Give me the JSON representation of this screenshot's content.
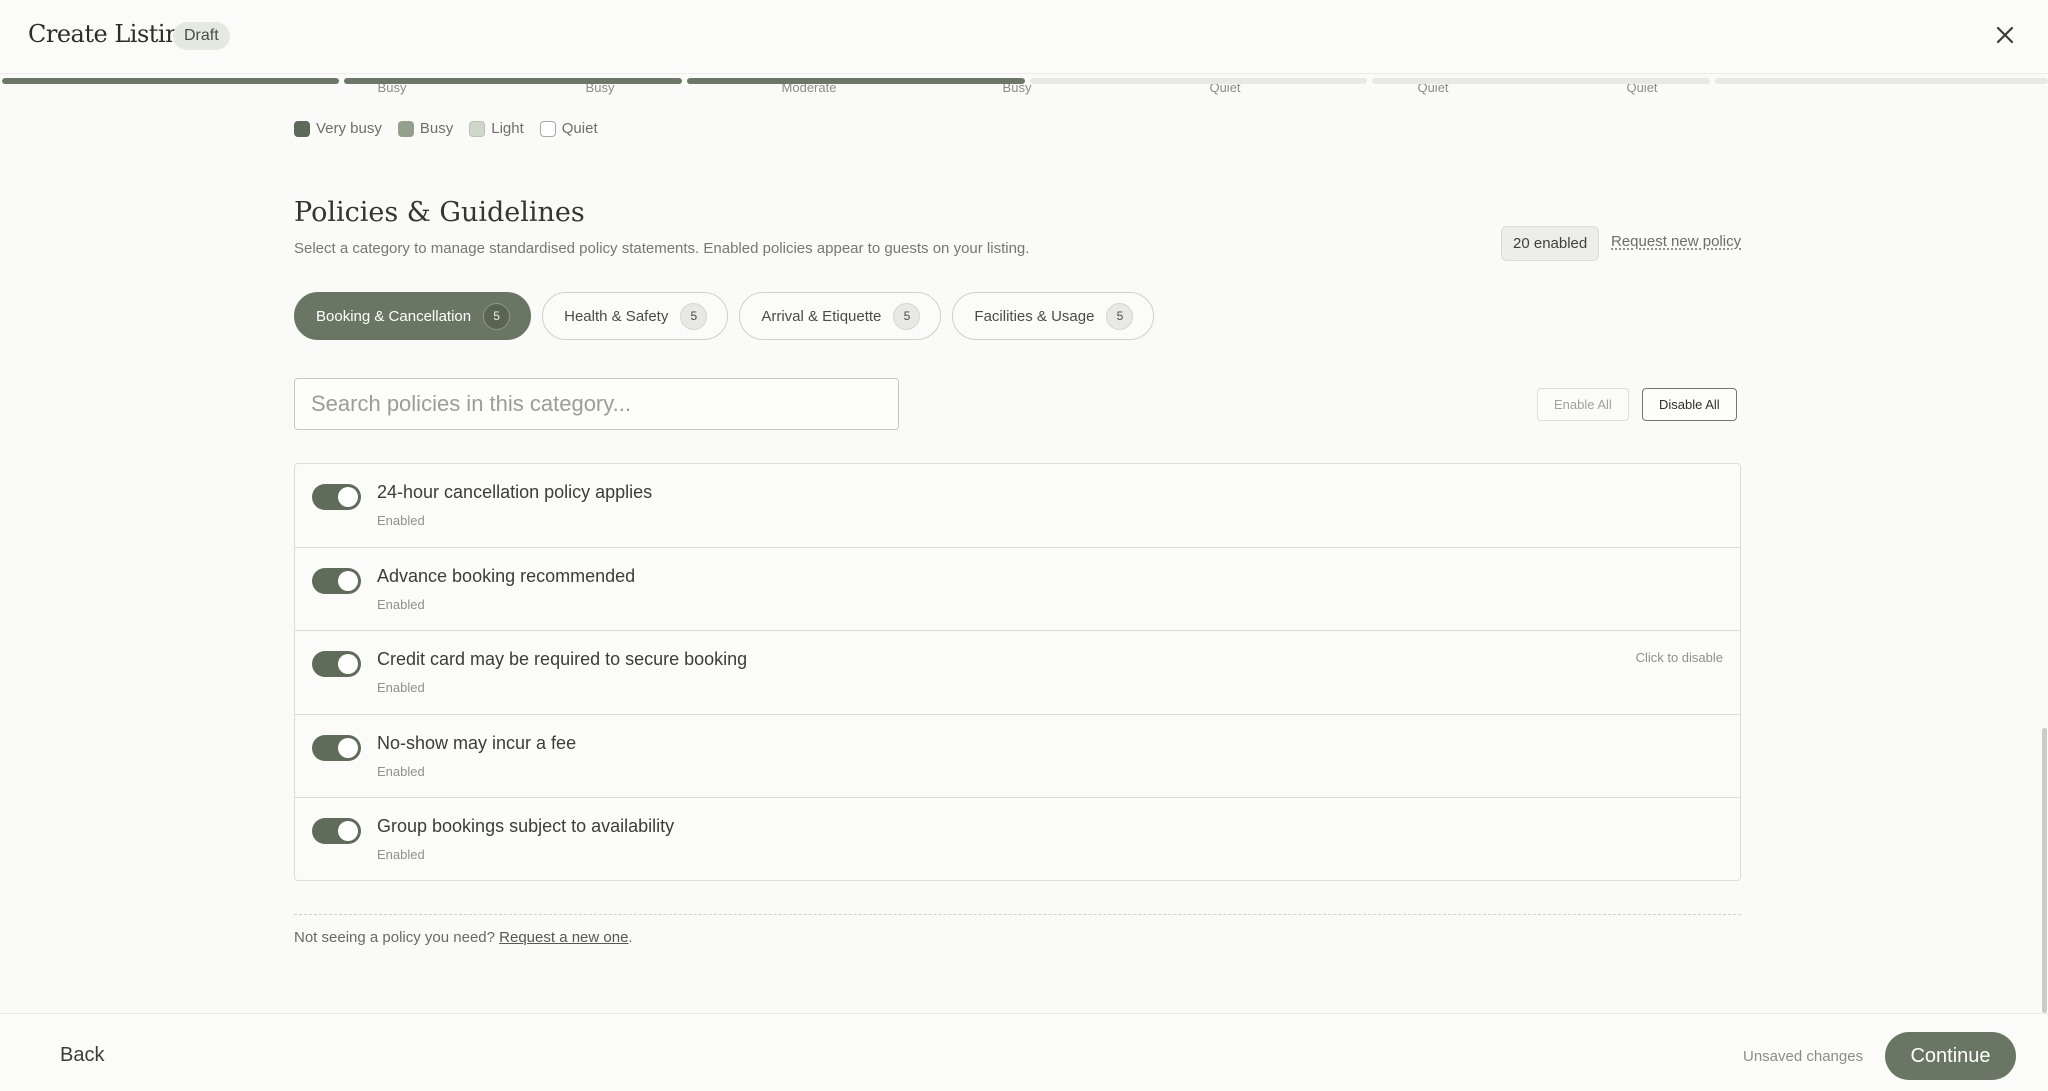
{
  "header": {
    "title": "Create Listing",
    "status_badge": "Draft"
  },
  "busyness": {
    "labels": [
      "Busy",
      "Busy",
      "Moderate",
      "Busy",
      "Quiet",
      "Quiet",
      "Quiet"
    ],
    "legend": [
      {
        "label": "Very busy",
        "color": "#5e6a58"
      },
      {
        "label": "Busy",
        "color": "#93a08c"
      },
      {
        "label": "Light",
        "color": "#cfd6ca"
      },
      {
        "label": "Quiet",
        "color": "#ffffff"
      }
    ]
  },
  "policies": {
    "title": "Policies & Guidelines",
    "description": "Select a category to manage standardised policy statements. Enabled policies appear to guests on your listing.",
    "enabled_count": "20 enabled",
    "request_link": "Request new policy",
    "tabs": [
      {
        "label": "Booking & Cancellation",
        "count": "5",
        "active": true
      },
      {
        "label": "Health & Safety",
        "count": "5",
        "active": false
      },
      {
        "label": "Arrival & Etiquette",
        "count": "5",
        "active": false
      },
      {
        "label": "Facilities & Usage",
        "count": "5",
        "active": false
      }
    ],
    "search_placeholder": "Search policies in this category...",
    "enable_all": "Enable All",
    "disable_all": "Disable All",
    "items": [
      {
        "title": "24-hour cancellation policy applies",
        "status": "Enabled",
        "hint": ""
      },
      {
        "title": "Advance booking recommended",
        "status": "Enabled",
        "hint": ""
      },
      {
        "title": "Credit card may be required to secure booking",
        "status": "Enabled",
        "hint": "Click to disable"
      },
      {
        "title": "No-show may incur a fee",
        "status": "Enabled",
        "hint": ""
      },
      {
        "title": "Group bookings subject to availability",
        "status": "Enabled",
        "hint": ""
      }
    ],
    "footnote_text": "Not seeing a policy you need?",
    "footnote_link": "Request a new one",
    "footnote_end": "."
  },
  "footer": {
    "back": "Back",
    "unsaved": "Unsaved changes",
    "continue": "Continue"
  },
  "colors": {
    "accent": "#6a7664",
    "toggle_on": "#606c5a"
  }
}
